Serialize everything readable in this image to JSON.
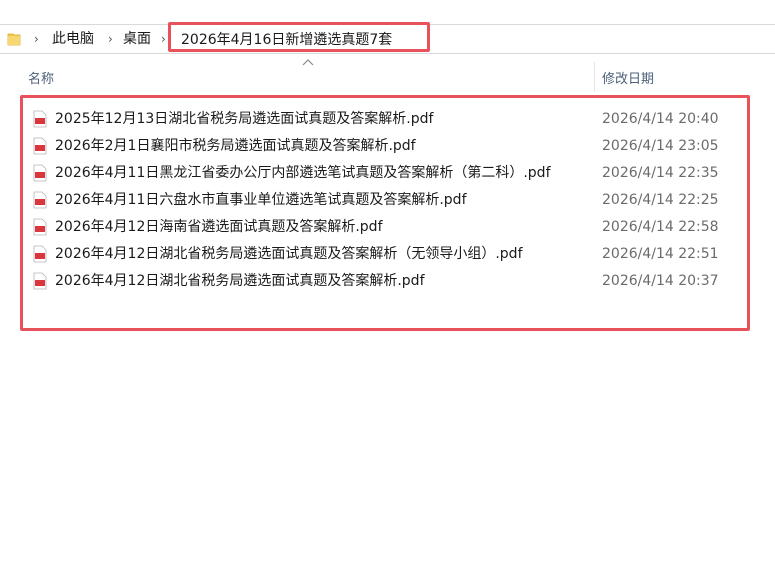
{
  "breadcrumb": {
    "items": [
      "此电脑",
      "桌面",
      "2026年4月16日新增遴选真题7套"
    ]
  },
  "columns": {
    "name": "名称",
    "modified": "修改日期"
  },
  "files": [
    {
      "name": "2025年12月13日湖北省税务局遴选面试真题及答案解析.pdf",
      "modified": "2026/4/14 20:40"
    },
    {
      "name": "2026年2月1日襄阳市税务局遴选面试真题及答案解析.pdf",
      "modified": "2026/4/14 23:05"
    },
    {
      "name": "2026年4月11日黑龙江省委办公厅内部遴选笔试真题及答案解析（第二科）.pdf",
      "modified": "2026/4/14 22:35"
    },
    {
      "name": "2026年4月11日六盘水市直事业单位遴选笔试真题及答案解析.pdf",
      "modified": "2026/4/14 22:25"
    },
    {
      "name": "2026年4月12日海南省遴选面试真题及答案解析.pdf",
      "modified": "2026/4/14 22:58"
    },
    {
      "name": "2026年4月12日湖北省税务局遴选面试真题及答案解析（无领导小组）.pdf",
      "modified": "2026/4/14 22:51"
    },
    {
      "name": "2026年4月12日湖北省税务局遴选面试真题及答案解析.pdf",
      "modified": "2026/4/14 20:37"
    }
  ],
  "icons": {
    "folder": "folder-icon",
    "file": "pdf-file-icon",
    "separator": "chevron-right-icon",
    "sort": "sort-ascending-icon"
  },
  "colors": {
    "highlight": "#e8525a",
    "folder": "#f2c94c",
    "pdf": "#d9363e",
    "header_text": "#4c607a",
    "date_text": "#6b6b6b"
  }
}
